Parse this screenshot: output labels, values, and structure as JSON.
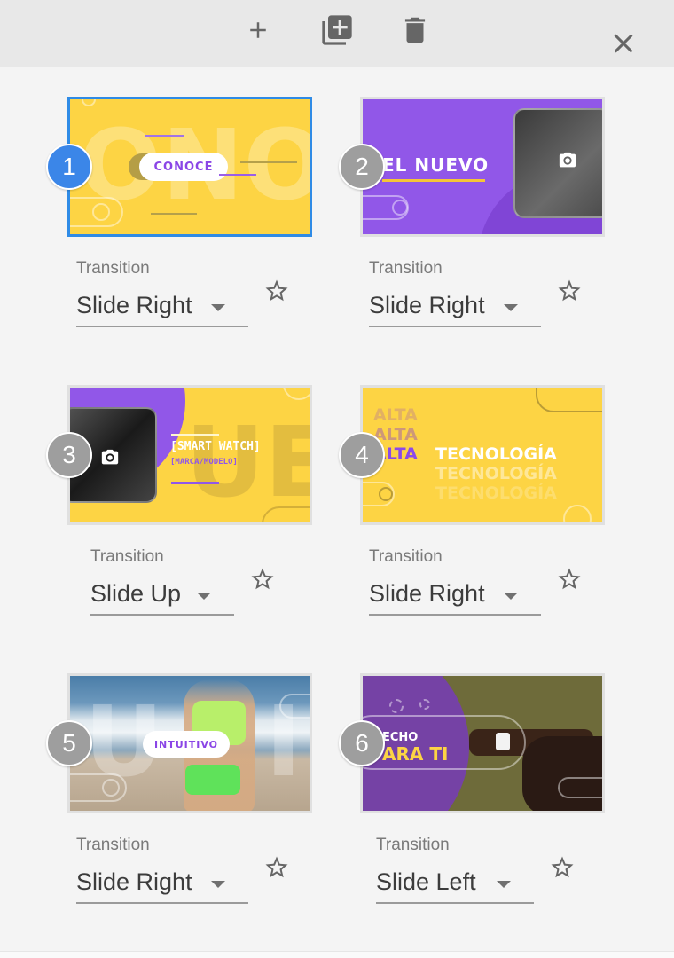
{
  "toolbar": {
    "buttons": [
      {
        "name": "add-slide",
        "icon": "plus-icon"
      },
      {
        "name": "duplicate-slide",
        "icon": "library-add-icon"
      },
      {
        "name": "delete-slide",
        "icon": "trash-icon"
      },
      {
        "name": "close",
        "icon": "close-icon"
      }
    ]
  },
  "colors": {
    "accent_selected": "#2f8be6",
    "badge_active": "#3b86e8",
    "badge_inactive": "#9e9e9e",
    "slide_yellow": "#fdd444",
    "slide_purple": "#9157e8"
  },
  "slides": [
    {
      "number": "1",
      "selected": true,
      "transition_label": "Transition",
      "transition": "Slide Right",
      "thumb_text": "CONOCE",
      "ghost_text": "ONOC"
    },
    {
      "number": "2",
      "selected": false,
      "transition_label": "Transition",
      "transition": "Slide Right",
      "thumb_text": "EL NUEVO"
    },
    {
      "number": "3",
      "selected": false,
      "transition_label": "Transition",
      "transition": "Slide Up",
      "thumb_text": "[SMART WATCH]",
      "thumb_subtext": "[MARCA/MODELO]",
      "ghost_text": "UEV"
    },
    {
      "number": "4",
      "selected": false,
      "transition_label": "Transition",
      "transition": "Slide Right",
      "thumb_text_left": "ALTA",
      "thumb_text_right": "TECNOLOGÍA"
    },
    {
      "number": "5",
      "selected": false,
      "transition_label": "Transition",
      "transition": "Slide Right",
      "thumb_text": "INTUITIVO"
    },
    {
      "number": "6",
      "selected": false,
      "transition_label": "Transition",
      "transition": "Slide Left",
      "thumb_text": "ECHO",
      "thumb_subtext": "ARA TI"
    }
  ]
}
